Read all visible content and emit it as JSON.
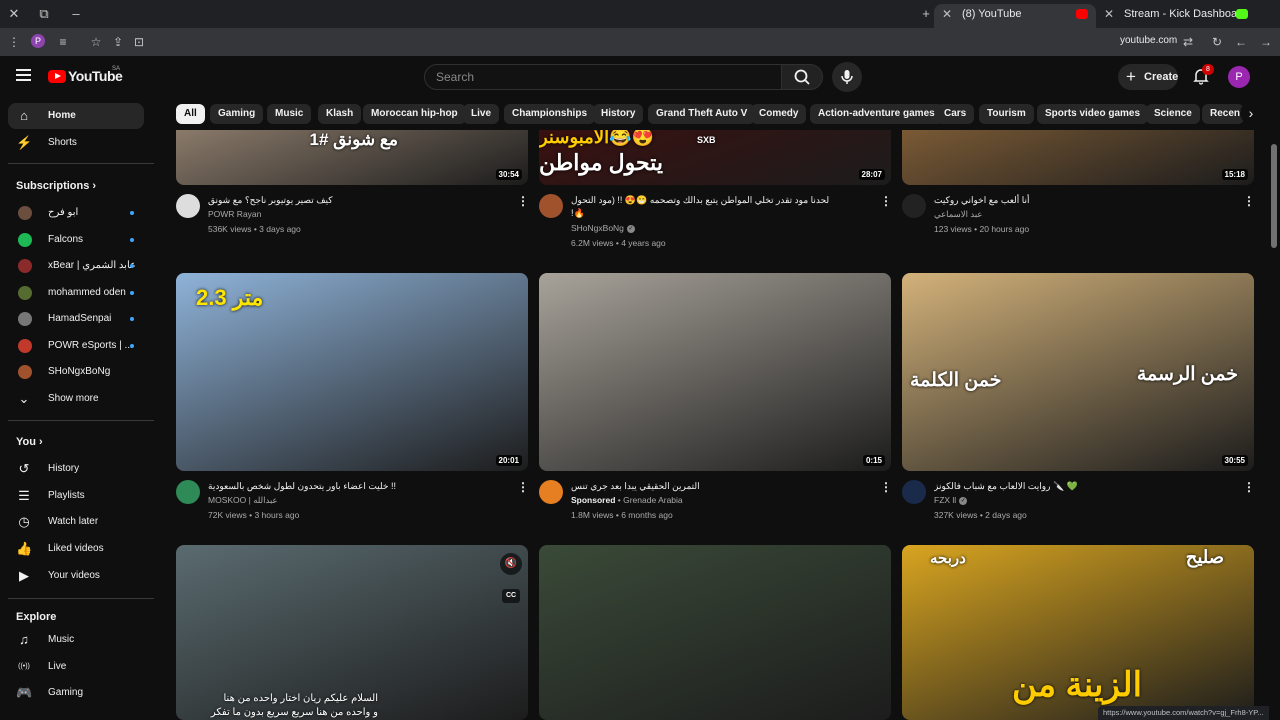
{
  "browser": {
    "tabs": [
      {
        "title": "(8) YouTube",
        "active": true
      },
      {
        "title": "Stream - Kick Dashboard",
        "active": false
      }
    ],
    "url": "youtube.com",
    "profile_initial": "P"
  },
  "header": {
    "logo_text": "YouTube",
    "logo_region": "SA",
    "search_placeholder": "Search",
    "create_label": "Create",
    "notifications_count": "8",
    "avatar_initial": "P"
  },
  "chips": [
    "All",
    "Gaming",
    "Music",
    "Klash",
    "Moroccan hip-hop",
    "Live",
    "Championships",
    "History",
    "Grand Theft Auto V",
    "Comedy",
    "Action-adventure games",
    "Cars",
    "Tourism",
    "Sports video games",
    "Science",
    "Recent"
  ],
  "sidebar": {
    "home": "Home",
    "shorts": "Shorts",
    "subscriptions_heading": "Subscriptions",
    "subscriptions": [
      {
        "name": "ابو فرح",
        "color": "#6b4e3d"
      },
      {
        "name": "Falcons",
        "color": "#1db954"
      },
      {
        "name": "xBear | عابد الشمري",
        "color": "#8b2a2a"
      },
      {
        "name": "mohammed oden",
        "color": "#556b2f"
      },
      {
        "name": "HamadSenpai",
        "color": "#777777"
      },
      {
        "name": "POWR eSports | ...",
        "color": "#c0392b"
      },
      {
        "name": "SHoNgxBoNg",
        "color": "#a0522d"
      }
    ],
    "show_more": "Show more",
    "you_heading": "You",
    "you_items": [
      "History",
      "Playlists",
      "Watch later",
      "Liked videos",
      "Your videos"
    ],
    "explore_heading": "Explore",
    "explore_items": [
      "Music",
      "Live",
      "Gaming"
    ]
  },
  "videos": [
    {
      "title": "كيف تصير يوتيوبر ناجح؟ مع شونق",
      "channel": "POWR Rayan",
      "meta": "536K views • 3 days ago",
      "duration": "30:54",
      "thumb_text": "مع شونق #1",
      "thumb_color": "#8a7a6a",
      "avatar": "#dddddd"
    },
    {
      "title": "لحدنا مود تقدر تخلي المواطن يتبع بدالك وتصحمه 😁😍 !! (مود التحول الاسطوري)",
      "title2": "!🔥",
      "channel": "SHoNgxBoNg",
      "meta": "6.2M views • 4 years ago",
      "duration": "28:07",
      "thumb_text": "يتحول مواطن",
      "thumb_text2": "الامبوسنر😂😍",
      "thumb_tag": "SXB",
      "thumb_color": "#3a1010",
      "avatar": "#a0522d",
      "verified": true
    },
    {
      "title": "أنا ألعب مع اخواني روكيت",
      "channel": "عبد الاسماعي",
      "meta": "123 views • 20 hours ago",
      "duration": "15:18",
      "thumb_color": "#7a5a35",
      "avatar": "#222222"
    },
    {
      "title": "خليت اعضاء باور يتحدون لطول شخص بالسعودية !!",
      "channel": "MOSKOO | عبدالله",
      "meta": "72K views • 3 hours ago",
      "duration": "20:01",
      "thumb_text": "2.3 متر",
      "thumb_color": "#8fb3d9",
      "avatar": "#2e8b57"
    },
    {
      "title": "التمرين الحقيقي يبدا بعد جري تنس",
      "channel": "Grenade Arabia",
      "sponsored": "Sponsored",
      "meta": "1.8M views • 6 months ago",
      "duration": "0:15",
      "thumb_color": "#a8a39a",
      "avatar": "#e67e22"
    },
    {
      "title": "روايت الالعاب مع شباب فالكونز 🔪 💚",
      "channel": "FZX ll",
      "meta": "327K views • 2 days ago",
      "duration": "30:55",
      "thumb_text": "خمن الكلمة",
      "thumb_text2": "خمن الرسمة",
      "thumb_color": "#d3b27a",
      "avatar": "#1a2a4a",
      "verified": true
    },
    {
      "title": "",
      "channel": "",
      "meta": "",
      "duration": "",
      "thumb_text": "السلام عليكم ريان اختار واحده من هنا",
      "thumb_text2": "و واحده من هنا سريع سريع بدون ما تفكر",
      "thumb_color": "#5a6b70",
      "avatar": "#333333"
    },
    {
      "title": "",
      "channel": "",
      "meta": "",
      "duration": "",
      "thumb_color": "#3a4a38",
      "avatar": "#333333"
    },
    {
      "title": "",
      "channel": "",
      "meta": "",
      "duration": "",
      "thumb_text": "دربحه",
      "thumb_text2": "صليح",
      "thumb_text3": "الزينة من",
      "thumb_color": "#d9a520",
      "avatar": "#333333"
    }
  ],
  "status_url": "https://www.youtube.com/watch?v=gj_Frh8-YP..."
}
